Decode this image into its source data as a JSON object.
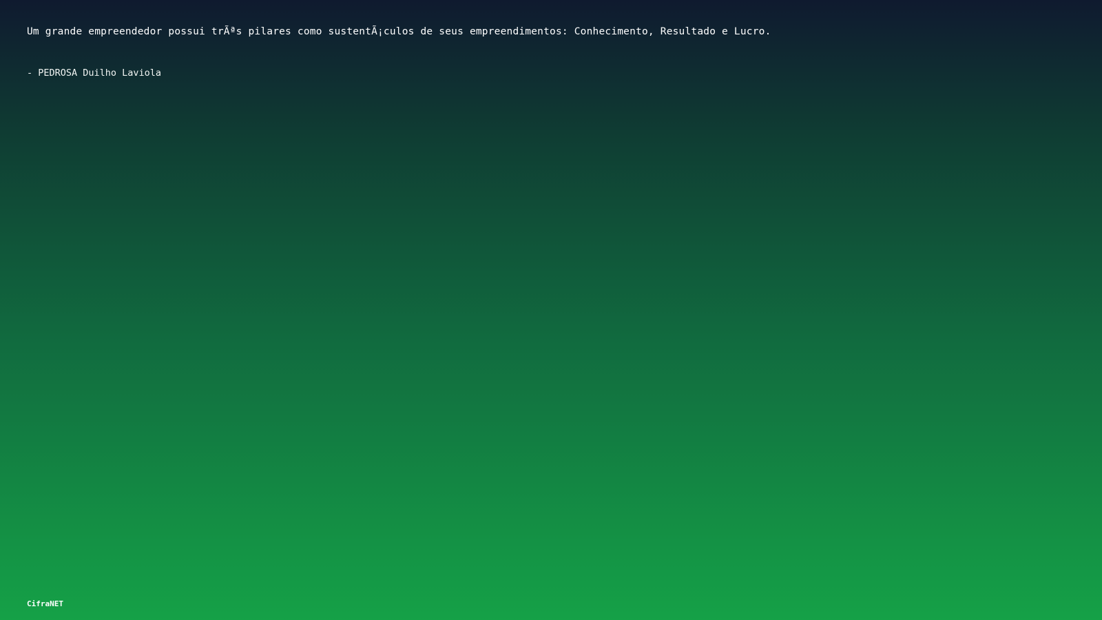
{
  "quote": {
    "text": "Um grande empreendedor possui trÃªs pilares como sustentÃ¡culos de seus empreendimentos: Conhecimento, Resultado e Lucro.",
    "author": "- PEDROSA Duilho Laviola"
  },
  "footer": {
    "brand": "CifraNET"
  },
  "colors": {
    "gradient_top": "#0f1a2f",
    "gradient_bottom": "#15a147",
    "text": "#ffffff"
  }
}
